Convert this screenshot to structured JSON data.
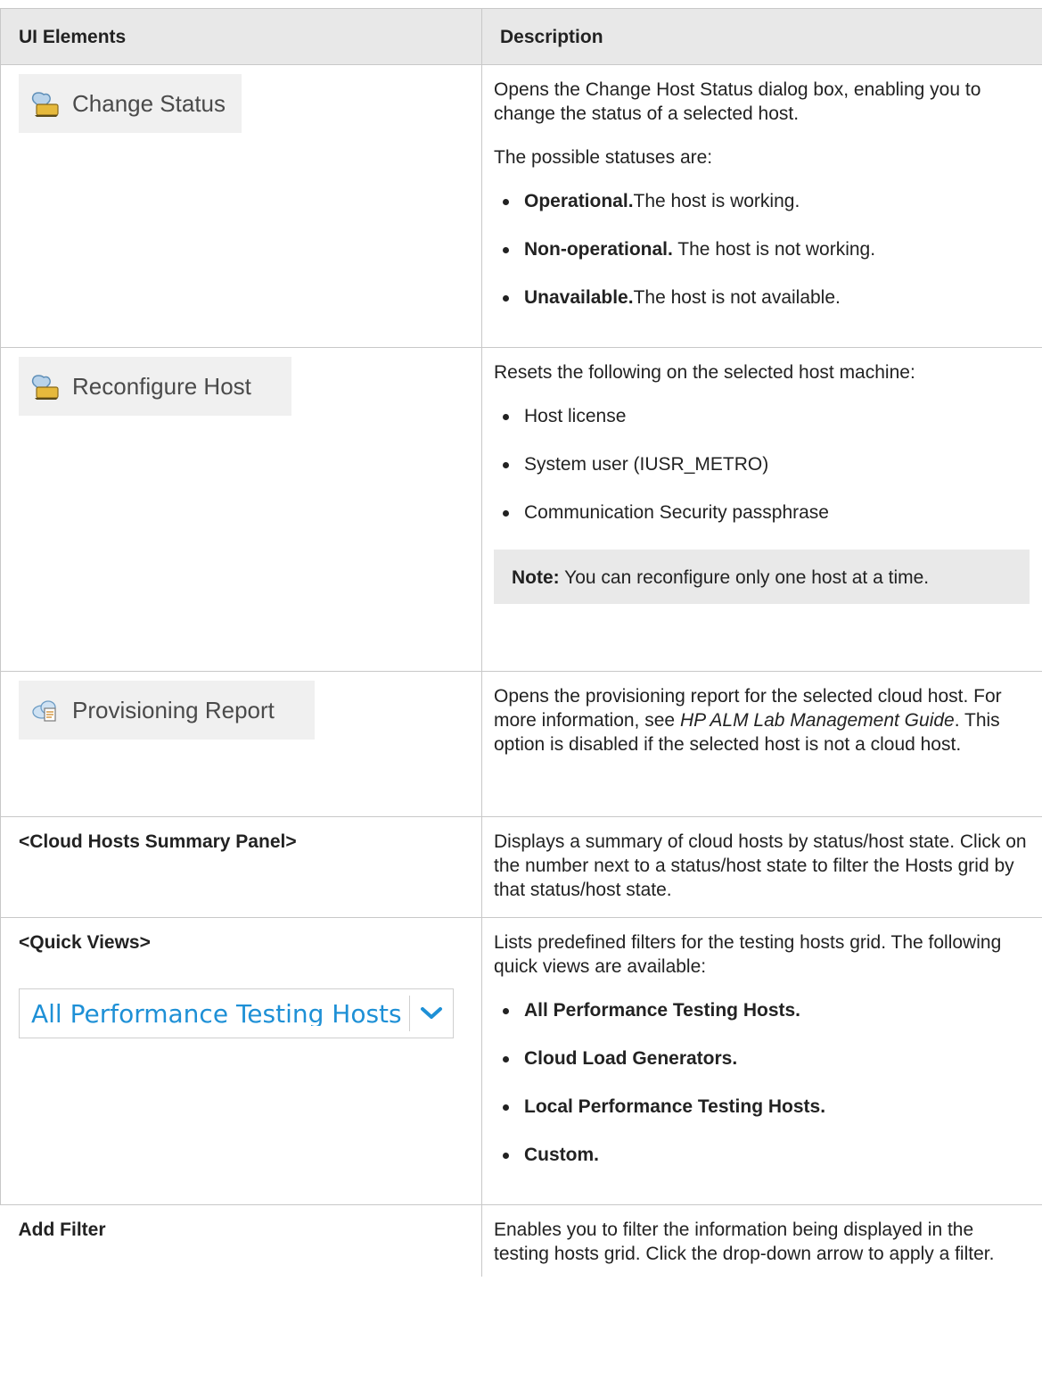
{
  "header": {
    "col1": "UI Elements",
    "col2": "Description"
  },
  "rows": {
    "change_status": {
      "element_label": "Change Status",
      "icon": "host-status-icon",
      "desc_intro": "Opens the Change Host Status dialog box, enabling you to change the status of a selected host.",
      "desc_lead": "The possible statuses are:",
      "statuses": [
        {
          "term": "Operational.",
          "text": "The host is working."
        },
        {
          "term": "Non-operational.",
          "text": " The host is not working."
        },
        {
          "term": "Unavailable.",
          "text": "The host is not available."
        }
      ]
    },
    "reconfigure": {
      "element_label": "Reconfigure Host",
      "icon": "host-status-icon",
      "desc_intro": "Resets the following on the selected host machine:",
      "items": [
        "Host license",
        "System user (IUSR_METRO)",
        "Communication Security passphrase"
      ],
      "note_label": "Note:",
      "note_text": " You can reconfigure only one host at a time."
    },
    "provisioning": {
      "element_label": "Provisioning Report",
      "icon": "cloud-report-icon",
      "desc_part1": "Opens the provisioning report for the selected cloud host. For more information, see ",
      "desc_italic": "HP ALM Lab Management Guide",
      "desc_part2": ". This option is disabled if the selected host is not a cloud host."
    },
    "cloud_summary": {
      "element_label": "<Cloud Hosts Summary Panel>",
      "desc": "Displays a summary of cloud hosts by status/host state. Click on the number next to a status/host state to filter the Hosts grid by that status/host state."
    },
    "quick_views": {
      "element_label": "<Quick Views>",
      "select_value": "All Performance Testing Hosts",
      "desc_intro": "Lists predefined filters for the testing hosts grid. The following quick views are available:",
      "views": [
        "All Performance Testing Hosts.",
        "Cloud Load Generators.",
        "Local Performance Testing Hosts.",
        "Custom."
      ]
    },
    "add_filter": {
      "element_label": "Add Filter",
      "desc": "Enables you to filter the information being displayed in the testing hosts grid. Click the drop-down arrow to apply a filter."
    }
  }
}
